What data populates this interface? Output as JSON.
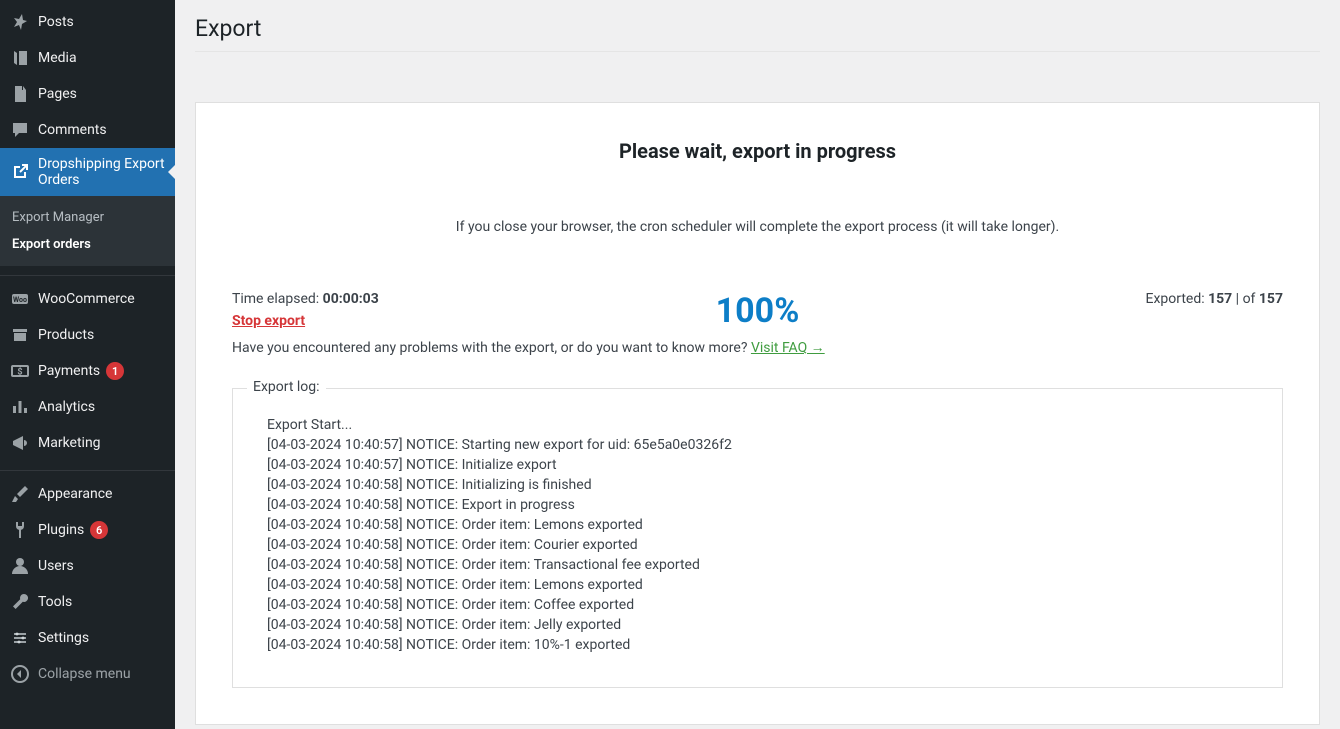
{
  "sidebar": {
    "items": [
      {
        "key": "posts",
        "label": "Posts",
        "icon": "pin"
      },
      {
        "key": "media",
        "label": "Media",
        "icon": "media"
      },
      {
        "key": "pages",
        "label": "Pages",
        "icon": "page"
      },
      {
        "key": "comments",
        "label": "Comments",
        "icon": "comment"
      },
      {
        "key": "dropshipping",
        "label": "Dropshipping Export Orders",
        "icon": "external",
        "current": true,
        "submenu": [
          {
            "key": "export-manager",
            "label": "Export Manager"
          },
          {
            "key": "export-orders",
            "label": "Export orders",
            "current": true
          }
        ]
      },
      {
        "sep": true
      },
      {
        "key": "woocommerce",
        "label": "WooCommerce",
        "icon": "woo"
      },
      {
        "key": "products",
        "label": "Products",
        "icon": "archive"
      },
      {
        "key": "payments",
        "label": "Payments",
        "icon": "payments",
        "badge": "1"
      },
      {
        "key": "analytics",
        "label": "Analytics",
        "icon": "analytics"
      },
      {
        "key": "marketing",
        "label": "Marketing",
        "icon": "megaphone"
      },
      {
        "sep": true
      },
      {
        "key": "appearance",
        "label": "Appearance",
        "icon": "brush"
      },
      {
        "key": "plugins",
        "label": "Plugins",
        "icon": "plug",
        "badge": "6"
      },
      {
        "key": "users",
        "label": "Users",
        "icon": "user"
      },
      {
        "key": "tools",
        "label": "Tools",
        "icon": "wrench"
      },
      {
        "key": "settings",
        "label": "Settings",
        "icon": "settings"
      },
      {
        "key": "collapse",
        "label": "Collapse menu",
        "icon": "collapse",
        "collapse": true
      }
    ]
  },
  "page": {
    "title": "Export",
    "progress_title": "Please wait, export in progress",
    "close_note": "If you close your browser, the cron scheduler will complete the export process (it will take longer).",
    "time_elapsed_label": "Time elapsed: ",
    "time_elapsed_value": "00:00:03",
    "percent": "100%",
    "exported_label": "Exported: ",
    "exported_count": "157",
    "exported_sep": " | of ",
    "exported_total": "157",
    "stop_label": "Stop export",
    "faq_prefix": "Have you encountered any problems with the export, or do you want to know more? ",
    "faq_link": "Visit FAQ →",
    "log_legend": "Export log:",
    "log_lines": [
      "Export Start...",
      "[04-03-2024 10:40:57] NOTICE: Starting new export for uid: 65e5a0e0326f2",
      "[04-03-2024 10:40:57] NOTICE: Initialize export",
      "[04-03-2024 10:40:58] NOTICE: Initializing is finished",
      "[04-03-2024 10:40:58] NOTICE: Export in progress",
      "[04-03-2024 10:40:58] NOTICE: Order item: Lemons exported",
      "[04-03-2024 10:40:58] NOTICE: Order item: Courier exported",
      "[04-03-2024 10:40:58] NOTICE: Order item: Transactional fee exported",
      "[04-03-2024 10:40:58] NOTICE: Order item: Lemons exported",
      "[04-03-2024 10:40:58] NOTICE: Order item: Coffee exported",
      "[04-03-2024 10:40:58] NOTICE: Order item: Jelly exported",
      "[04-03-2024 10:40:58] NOTICE: Order item: 10%-1 exported"
    ]
  }
}
